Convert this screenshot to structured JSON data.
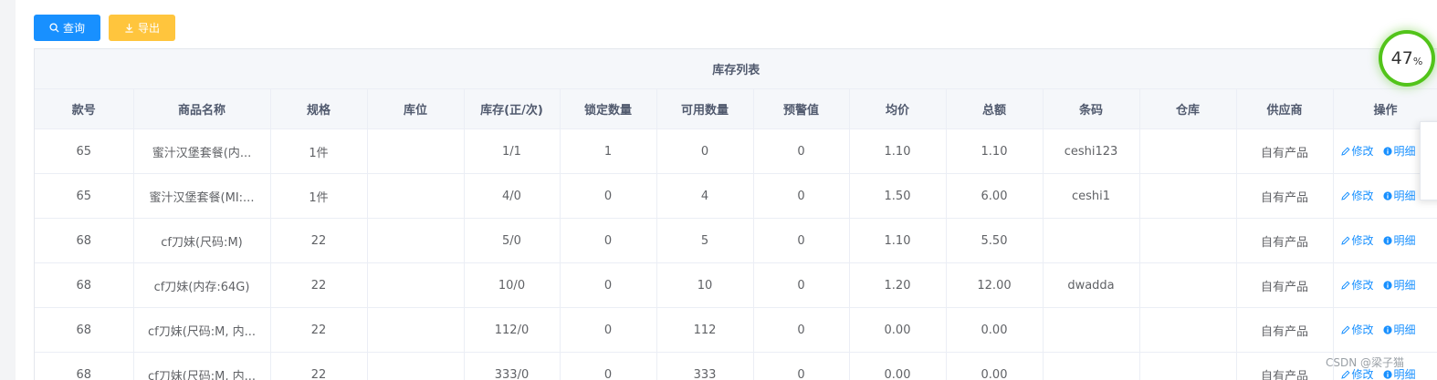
{
  "toolbar": {
    "query_label": "查询",
    "export_label": "导出"
  },
  "table": {
    "title": "库存列表",
    "headers": [
      "款号",
      "商品名称",
      "规格",
      "库位",
      "库存(正/次)",
      "锁定数量",
      "可用数量",
      "预警值",
      "均价",
      "总额",
      "条码",
      "仓库",
      "供应商",
      "操作"
    ],
    "rows": [
      [
        "65",
        "蜜汁汉堡套餐(内...",
        "1件",
        "",
        "1/1",
        "1",
        "0",
        "0",
        "1.10",
        "1.10",
        "ceshi123",
        "",
        "自有产品"
      ],
      [
        "65",
        "蜜汁汉堡套餐(MI:...",
        "1件",
        "",
        "4/0",
        "0",
        "4",
        "0",
        "1.50",
        "6.00",
        "ceshi1",
        "",
        "自有产品"
      ],
      [
        "68",
        "cf刀妹(尺码:M)",
        "22",
        "",
        "5/0",
        "0",
        "5",
        "0",
        "1.10",
        "5.50",
        "",
        "",
        "自有产品"
      ],
      [
        "68",
        "cf刀妹(内存:64G)",
        "22",
        "",
        "10/0",
        "0",
        "10",
        "0",
        "1.20",
        "12.00",
        "dwadda",
        "",
        "自有产品"
      ],
      [
        "68",
        "cf刀妹(尺码:M, 内...",
        "22",
        "",
        "112/0",
        "0",
        "112",
        "0",
        "0.00",
        "0.00",
        "",
        "",
        "自有产品"
      ],
      [
        "68",
        "cf刀妹(尺码:M, 内...",
        "22",
        "",
        "333/0",
        "0",
        "333",
        "0",
        "0.00",
        "0.00",
        "",
        "",
        "自有产品"
      ]
    ],
    "actions": {
      "edit_label": "修改",
      "detail_label": "明细"
    }
  },
  "progress": {
    "value": "47",
    "unit": "%"
  },
  "watermark": "CSDN @梁子猫",
  "colors": {
    "primary": "#1890ff",
    "warning": "#ffc53d",
    "success": "#52c41a"
  }
}
